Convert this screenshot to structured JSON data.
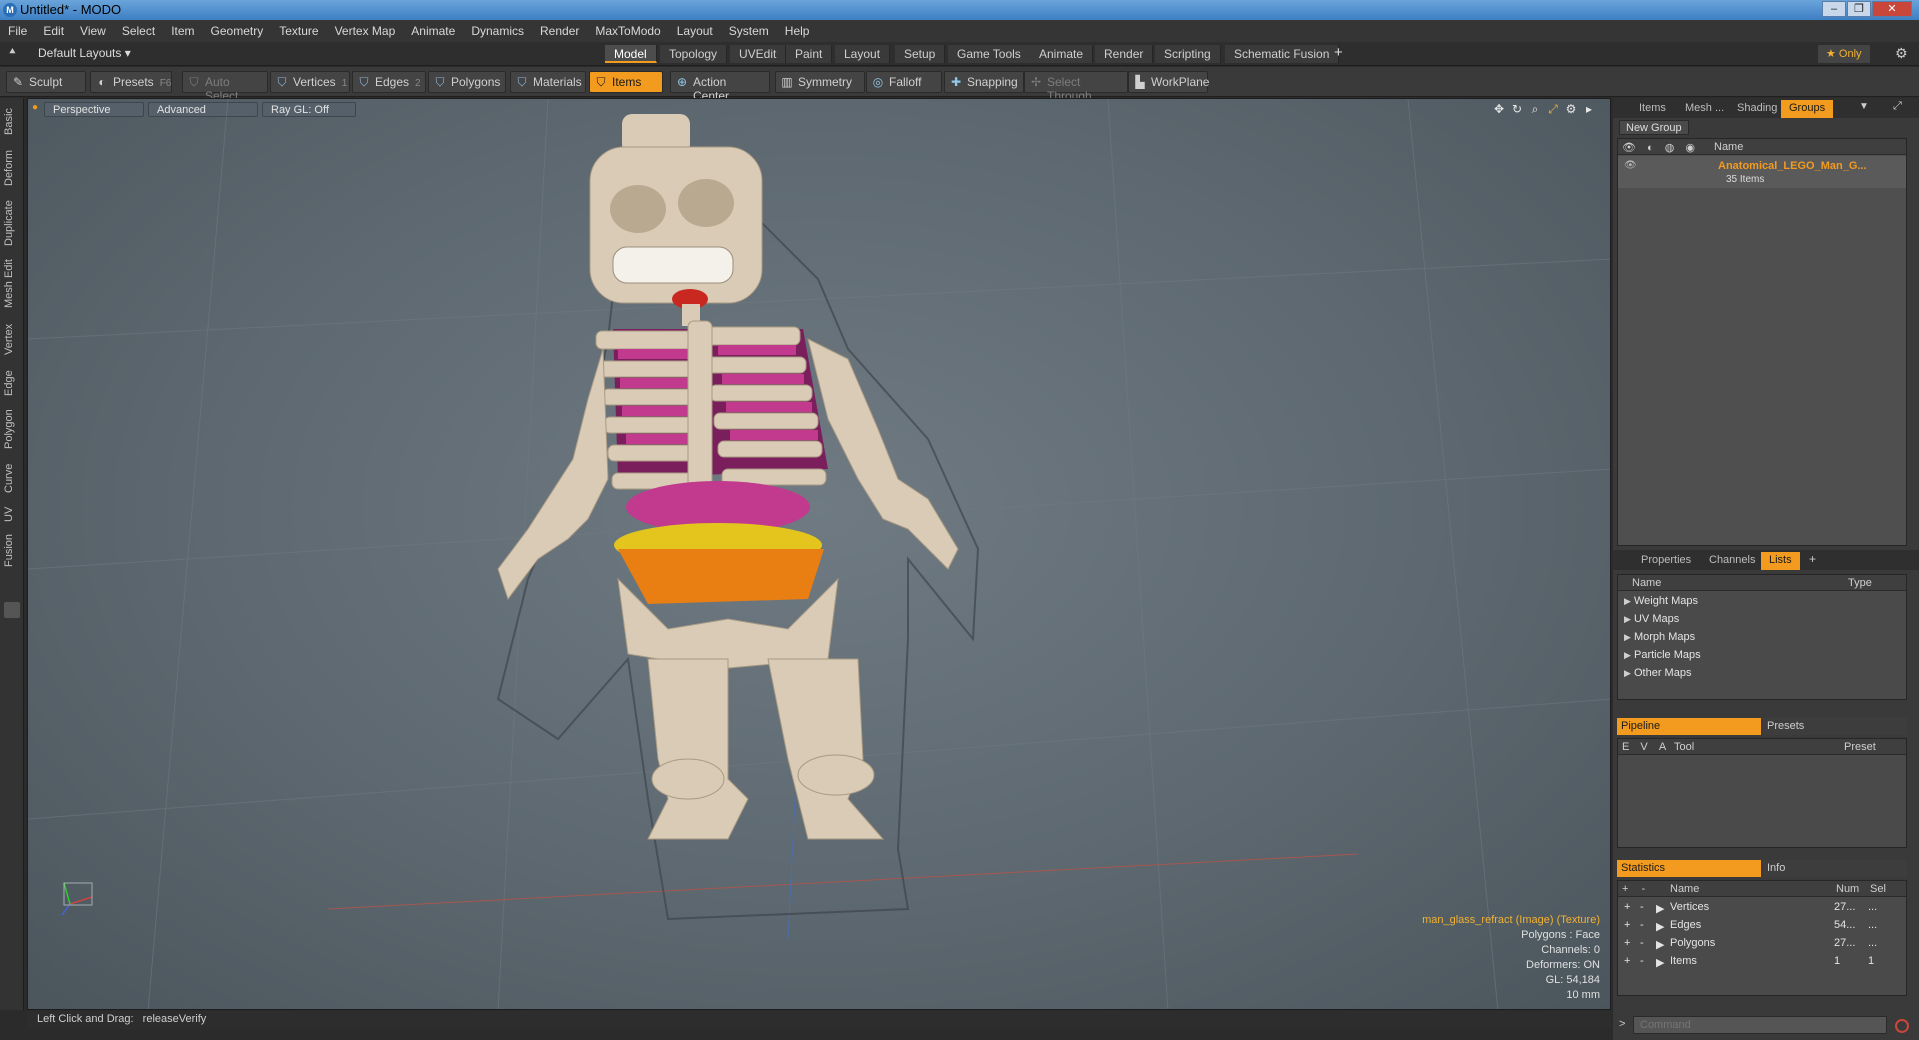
{
  "window": {
    "title": "Untitled* - MODO",
    "app_icon": "modo-logo-icon"
  },
  "menu": [
    "File",
    "Edit",
    "View",
    "Select",
    "Item",
    "Geometry",
    "Texture",
    "Vertex Map",
    "Animate",
    "Dynamics",
    "Render",
    "MaxToModo",
    "Layout",
    "System",
    "Help"
  ],
  "layout_bar": {
    "layouts_label": "Default Layouts ▾",
    "tabs": [
      "Model",
      "Topology",
      "UVEdit",
      "Paint",
      "Layout",
      "Setup",
      "Game Tools",
      "Animate",
      "Render",
      "Scripting",
      "Schematic Fusion"
    ],
    "active_tab": "Model",
    "add": "+",
    "only_label": "★ Only"
  },
  "toolbar": {
    "sculpt": "Sculpt",
    "presets": "Presets",
    "presets_key": "F6",
    "auto_select": "Auto Select",
    "vertices": "Vertices",
    "vertices_key": "1",
    "edges": "Edges",
    "edges_key": "2",
    "polygons": "Polygons",
    "materials": "Materials",
    "items": "Items",
    "action_center": "Action Center",
    "symmetry": "Symmetry",
    "falloff": "Falloff",
    "snapping": "Snapping",
    "select_through": "Select Through",
    "workplane": "WorkPlane"
  },
  "left_tabs": [
    "Basic",
    "Deform",
    "Duplicate",
    "Mesh Edit",
    "Vertex",
    "Edge",
    "Polygon",
    "Curve",
    "UV",
    "Fusion"
  ],
  "viewport": {
    "view_mode": "Perspective",
    "shading": "Advanced",
    "raygl": "Ray GL: Off",
    "info": {
      "texture": "man_glass_refract (Image) (Texture)",
      "polygons": "Polygons : Face",
      "channels": "Channels: 0",
      "deformers": "Deformers: ON",
      "gl": "GL: 54,184",
      "scale": "10 mm"
    }
  },
  "status": {
    "hint": "Left Click and Drag:",
    "action": "releaseVerify"
  },
  "right_panel": {
    "top_tabs": [
      "Items",
      "Mesh ...",
      "Shading",
      "Groups"
    ],
    "active_top_tab": "Groups",
    "new_group": "New Group",
    "groups_col_name": "Name",
    "group_name": "Anatomical_LEGO_Man_G...",
    "group_count": "35 Items",
    "mid_tabs": [
      "Properties",
      "Channels",
      "Lists"
    ],
    "active_mid_tab": "Lists",
    "lists_col_name": "Name",
    "lists_col_type": "Type",
    "lists": [
      "Weight Maps",
      "UV Maps",
      "Morph Maps",
      "Particle Maps",
      "Other Maps"
    ],
    "pipeline": "Pipeline",
    "presets": "Presets",
    "pipe_cols": {
      "e": "E",
      "v": "V",
      "a": "A",
      "tool": "Tool",
      "preset": "Preset"
    },
    "statistics": "Statistics",
    "info": "Info",
    "stat_cols": {
      "plus": "+",
      "minus": "-",
      "name": "Name",
      "num": "Num",
      "sel": "Sel"
    },
    "stats": [
      {
        "name": "Vertices",
        "num": "27...",
        "sel": "..."
      },
      {
        "name": "Edges",
        "num": "54...",
        "sel": "..."
      },
      {
        "name": "Polygons",
        "num": "27...",
        "sel": "..."
      },
      {
        "name": "Items",
        "num": "1",
        "sel": "1"
      }
    ],
    "command_placeholder": "Command"
  },
  "colors": {
    "accent": "#f29b1e",
    "viewport": "#5d6870",
    "bone": "#d9cbb5",
    "organ_pink": "#c23a8e",
    "organ_yellow": "#e3c51e",
    "organ_orange": "#e97f12",
    "organ_purple": "#7a1f5c"
  }
}
